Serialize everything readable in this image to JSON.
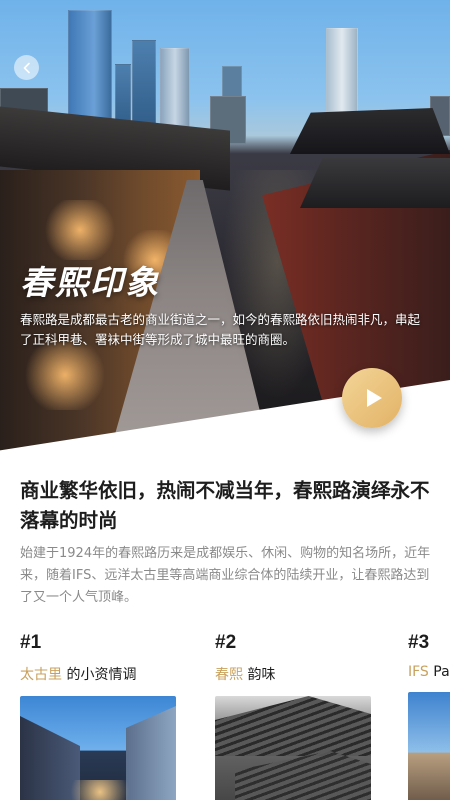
{
  "hero": {
    "title": "春熙印象",
    "description": "春熙路是成都最古老的商业街道之一，如今的春熙路依旧热闹非凡，串起了正科甲巷、署袜中街等形成了城中最旺的商圈。"
  },
  "article": {
    "headline": "商业繁华依旧，热闹不减当年，春熙路演绎永不落幕的时尚",
    "intro": "始建于1924年的春熙路历来是成都娱乐、休闲、购物的知名场所，近年来，随着IFS、远洋太古里等高端商业综合体的陆续开业，让春熙路达到了又一个人气顶峰。"
  },
  "cards": [
    {
      "number": "#1",
      "accent": "太古里",
      "rest": " 的小资情调"
    },
    {
      "number": "#2",
      "accent": "春熙",
      "rest": " 韵味"
    },
    {
      "number": "#3",
      "accent": "IFS",
      "rest": " Pa"
    }
  ],
  "colors": {
    "accent": "#c9a15e",
    "play_button": "#e9c37a"
  },
  "icons": {
    "back": "chevron-left-icon",
    "play": "play-icon"
  }
}
